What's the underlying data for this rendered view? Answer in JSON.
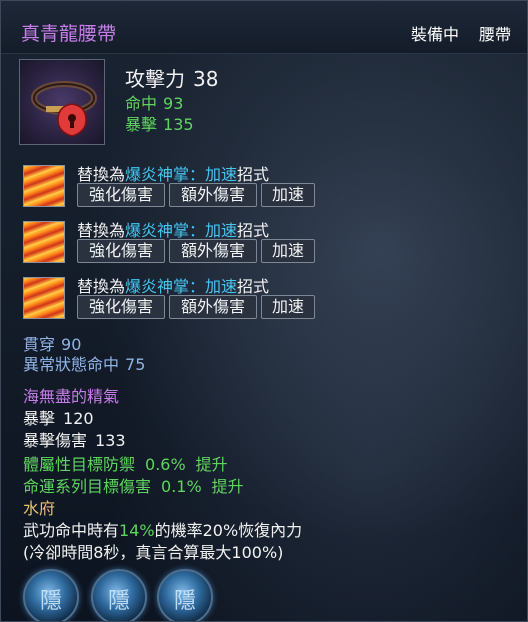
{
  "header": {
    "item_name": "真青龍腰帶",
    "equip_status": "裝備中",
    "slot_type": "腰帶"
  },
  "item": {
    "icon": "red-lock-belt-icon",
    "attack_label": "攻擊力",
    "attack_value": "38",
    "stats": [
      {
        "label": "命中",
        "value": "93"
      },
      {
        "label": "暴擊",
        "value": "135"
      }
    ]
  },
  "skills": [
    {
      "prefix": "替換為",
      "skill": "爆炎神掌：加速",
      "suffix": "招式",
      "tags": [
        "強化傷害",
        "額外傷害",
        "加速"
      ]
    },
    {
      "prefix": "替換為",
      "skill": "爆炎神掌：加速",
      "suffix": "招式",
      "tags": [
        "強化傷害",
        "額外傷害",
        "加速"
      ]
    },
    {
      "prefix": "替換為",
      "skill": "爆炎神掌：加速",
      "suffix": "招式",
      "tags": [
        "強化傷害",
        "額外傷害",
        "加速"
      ]
    }
  ],
  "attributes": [
    {
      "label": "貫穿",
      "value": "90"
    },
    {
      "label": "異常狀態命中",
      "value": "75"
    }
  ],
  "set": {
    "name": "海無盡的精氣",
    "stats": [
      {
        "label": "暴擊",
        "value": "120"
      },
      {
        "label": "暴擊傷害",
        "value": "133"
      }
    ],
    "bonuses": [
      {
        "label": "體屬性目標防禦",
        "value": "0.6%",
        "suffix": "提升"
      },
      {
        "label": "命運系列目標傷害",
        "value": "0.1%",
        "suffix": "提升"
      }
    ]
  },
  "soul_shield": {
    "name": "水府",
    "desc_a": "武功命中時有",
    "desc_pct": "14%",
    "desc_b": "的機率20%恢復內力",
    "desc_line2": "(冷卻時間8秒，真言合算最大100%)"
  },
  "gems": [
    {
      "glyph": "隱"
    },
    {
      "glyph": "隱"
    },
    {
      "glyph": "隱"
    }
  ],
  "colors": {
    "item_name": "#c57de8",
    "green_stat": "#5fd55f",
    "skill_highlight": "#46c6f0",
    "attribute": "#8fb4e6",
    "soul_name": "#e8c070"
  }
}
